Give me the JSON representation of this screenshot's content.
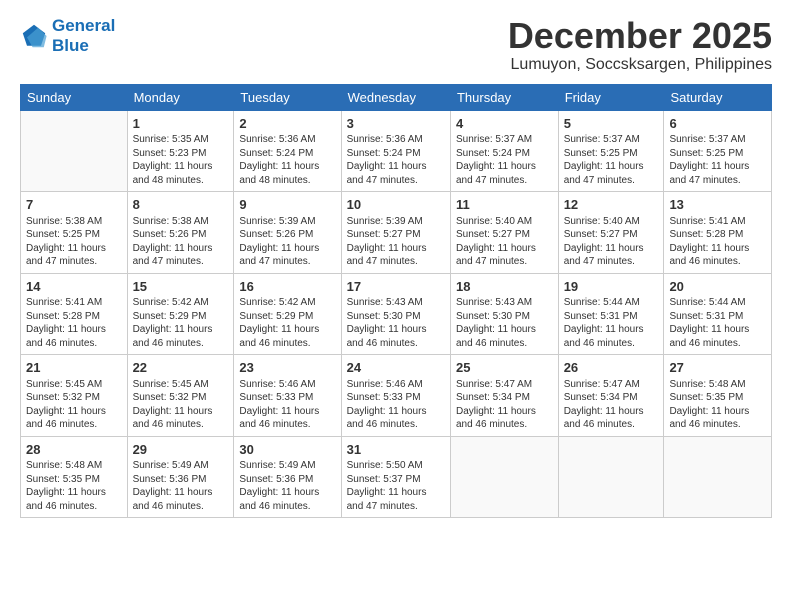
{
  "header": {
    "logo_line1": "General",
    "logo_line2": "Blue",
    "title": "December 2025",
    "subtitle": "Lumuyon, Soccsksargen, Philippines"
  },
  "calendar": {
    "days_of_week": [
      "Sunday",
      "Monday",
      "Tuesday",
      "Wednesday",
      "Thursday",
      "Friday",
      "Saturday"
    ],
    "weeks": [
      [
        {
          "day": "",
          "info": ""
        },
        {
          "day": "1",
          "info": "Sunrise: 5:35 AM\nSunset: 5:23 PM\nDaylight: 11 hours\nand 48 minutes."
        },
        {
          "day": "2",
          "info": "Sunrise: 5:36 AM\nSunset: 5:24 PM\nDaylight: 11 hours\nand 48 minutes."
        },
        {
          "day": "3",
          "info": "Sunrise: 5:36 AM\nSunset: 5:24 PM\nDaylight: 11 hours\nand 47 minutes."
        },
        {
          "day": "4",
          "info": "Sunrise: 5:37 AM\nSunset: 5:24 PM\nDaylight: 11 hours\nand 47 minutes."
        },
        {
          "day": "5",
          "info": "Sunrise: 5:37 AM\nSunset: 5:25 PM\nDaylight: 11 hours\nand 47 minutes."
        },
        {
          "day": "6",
          "info": "Sunrise: 5:37 AM\nSunset: 5:25 PM\nDaylight: 11 hours\nand 47 minutes."
        }
      ],
      [
        {
          "day": "7",
          "info": "Sunrise: 5:38 AM\nSunset: 5:25 PM\nDaylight: 11 hours\nand 47 minutes."
        },
        {
          "day": "8",
          "info": "Sunrise: 5:38 AM\nSunset: 5:26 PM\nDaylight: 11 hours\nand 47 minutes."
        },
        {
          "day": "9",
          "info": "Sunrise: 5:39 AM\nSunset: 5:26 PM\nDaylight: 11 hours\nand 47 minutes."
        },
        {
          "day": "10",
          "info": "Sunrise: 5:39 AM\nSunset: 5:27 PM\nDaylight: 11 hours\nand 47 minutes."
        },
        {
          "day": "11",
          "info": "Sunrise: 5:40 AM\nSunset: 5:27 PM\nDaylight: 11 hours\nand 47 minutes."
        },
        {
          "day": "12",
          "info": "Sunrise: 5:40 AM\nSunset: 5:27 PM\nDaylight: 11 hours\nand 47 minutes."
        },
        {
          "day": "13",
          "info": "Sunrise: 5:41 AM\nSunset: 5:28 PM\nDaylight: 11 hours\nand 46 minutes."
        }
      ],
      [
        {
          "day": "14",
          "info": "Sunrise: 5:41 AM\nSunset: 5:28 PM\nDaylight: 11 hours\nand 46 minutes."
        },
        {
          "day": "15",
          "info": "Sunrise: 5:42 AM\nSunset: 5:29 PM\nDaylight: 11 hours\nand 46 minutes."
        },
        {
          "day": "16",
          "info": "Sunrise: 5:42 AM\nSunset: 5:29 PM\nDaylight: 11 hours\nand 46 minutes."
        },
        {
          "day": "17",
          "info": "Sunrise: 5:43 AM\nSunset: 5:30 PM\nDaylight: 11 hours\nand 46 minutes."
        },
        {
          "day": "18",
          "info": "Sunrise: 5:43 AM\nSunset: 5:30 PM\nDaylight: 11 hours\nand 46 minutes."
        },
        {
          "day": "19",
          "info": "Sunrise: 5:44 AM\nSunset: 5:31 PM\nDaylight: 11 hours\nand 46 minutes."
        },
        {
          "day": "20",
          "info": "Sunrise: 5:44 AM\nSunset: 5:31 PM\nDaylight: 11 hours\nand 46 minutes."
        }
      ],
      [
        {
          "day": "21",
          "info": "Sunrise: 5:45 AM\nSunset: 5:32 PM\nDaylight: 11 hours\nand 46 minutes."
        },
        {
          "day": "22",
          "info": "Sunrise: 5:45 AM\nSunset: 5:32 PM\nDaylight: 11 hours\nand 46 minutes."
        },
        {
          "day": "23",
          "info": "Sunrise: 5:46 AM\nSunset: 5:33 PM\nDaylight: 11 hours\nand 46 minutes."
        },
        {
          "day": "24",
          "info": "Sunrise: 5:46 AM\nSunset: 5:33 PM\nDaylight: 11 hours\nand 46 minutes."
        },
        {
          "day": "25",
          "info": "Sunrise: 5:47 AM\nSunset: 5:34 PM\nDaylight: 11 hours\nand 46 minutes."
        },
        {
          "day": "26",
          "info": "Sunrise: 5:47 AM\nSunset: 5:34 PM\nDaylight: 11 hours\nand 46 minutes."
        },
        {
          "day": "27",
          "info": "Sunrise: 5:48 AM\nSunset: 5:35 PM\nDaylight: 11 hours\nand 46 minutes."
        }
      ],
      [
        {
          "day": "28",
          "info": "Sunrise: 5:48 AM\nSunset: 5:35 PM\nDaylight: 11 hours\nand 46 minutes."
        },
        {
          "day": "29",
          "info": "Sunrise: 5:49 AM\nSunset: 5:36 PM\nDaylight: 11 hours\nand 46 minutes."
        },
        {
          "day": "30",
          "info": "Sunrise: 5:49 AM\nSunset: 5:36 PM\nDaylight: 11 hours\nand 46 minutes."
        },
        {
          "day": "31",
          "info": "Sunrise: 5:50 AM\nSunset: 5:37 PM\nDaylight: 11 hours\nand 47 minutes."
        },
        {
          "day": "",
          "info": ""
        },
        {
          "day": "",
          "info": ""
        },
        {
          "day": "",
          "info": ""
        }
      ]
    ]
  }
}
